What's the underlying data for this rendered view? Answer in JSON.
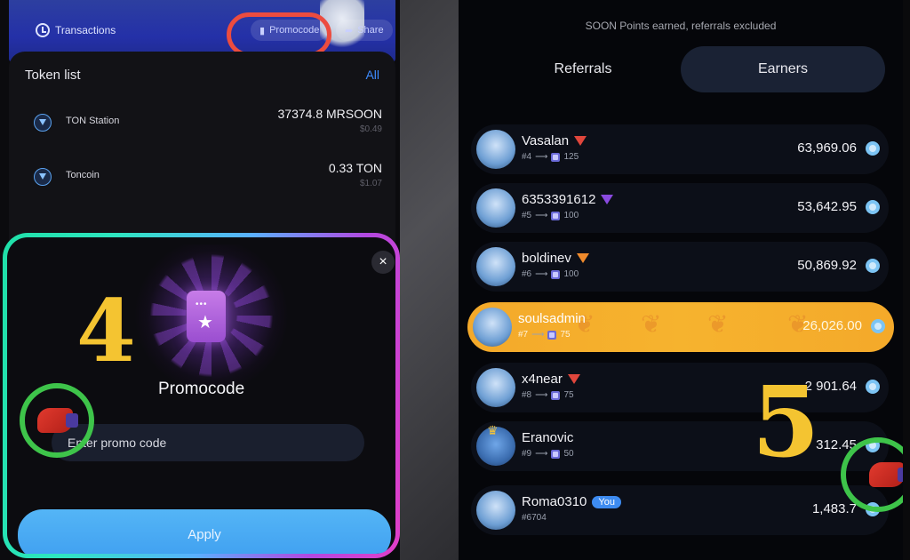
{
  "left": {
    "header": {
      "transactions_label": "Transactions",
      "promocode_label": "Promocode",
      "share_label": "Share"
    },
    "token_list": {
      "title": "Token list",
      "all_label": "All",
      "items": [
        {
          "name": "TON Station",
          "amount": "37374.8 MRSOON",
          "usd": "$0.49"
        },
        {
          "name": "Toncoin",
          "amount": "0.33 TON",
          "usd": "$1.07"
        }
      ]
    },
    "promo_modal": {
      "close_glyph": "×",
      "title": "Promocode",
      "input_placeholder": "Enter promo code",
      "apply_label": "Apply",
      "step_number": "4"
    }
  },
  "right": {
    "note": "SOON Points earned, referrals excluded",
    "tabs": [
      "Referrals",
      "Earners"
    ],
    "active_tab": "Earners",
    "step_number": "5",
    "leaderboard": [
      {
        "name": "Vasalan",
        "rank": "#4",
        "level": "125",
        "value": "63,969.06",
        "gem": "red"
      },
      {
        "name": "6353391612",
        "rank": "#5",
        "level": "100",
        "value": "53,642.95",
        "gem": "purple"
      },
      {
        "name": "boldinev",
        "rank": "#6",
        "level": "100",
        "value": "50,869.92",
        "gem": "orange"
      },
      {
        "name": "soulsadmin",
        "rank": "#7",
        "level": "75",
        "value": "26,026.00",
        "gem": ""
      },
      {
        "name": "x4near",
        "rank": "#8",
        "level": "75",
        "value": "2 901.64",
        "gem": "red"
      },
      {
        "name": "Eranovic",
        "rank": "#9",
        "level": "50",
        "value": "312.45",
        "gem": ""
      },
      {
        "name": "Roma0310",
        "rank": "#6704",
        "level": "",
        "value": "1,483.7",
        "badge": "You"
      }
    ]
  },
  "colors": {
    "accent_blue": "#3d8bff",
    "apply_blue": "#4aa8f3",
    "highlight_orange": "#f4a92a",
    "ring_red": "#ec4c3f",
    "ring_green": "#3ec44a",
    "step_yellow": "#f4c431"
  }
}
